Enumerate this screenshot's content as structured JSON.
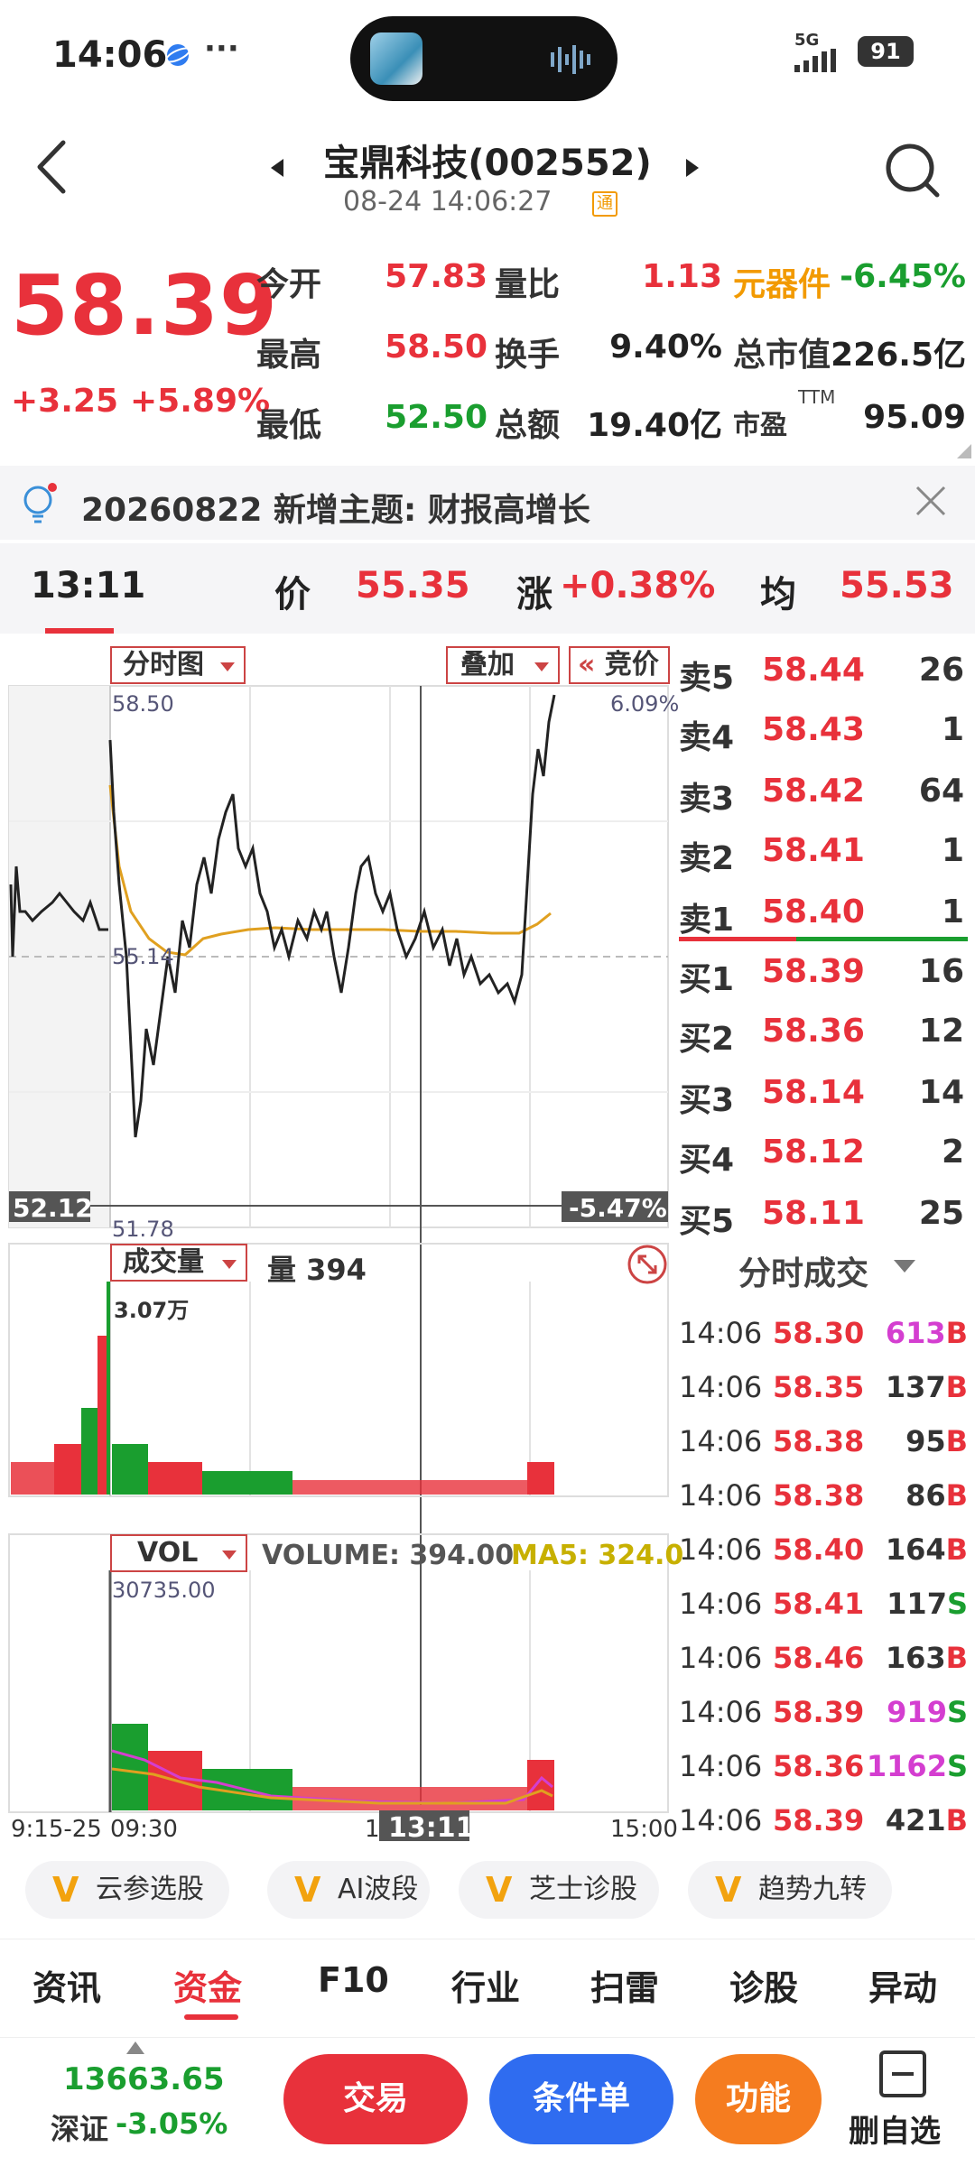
{
  "status_bar": {
    "time": "14:06",
    "extra": "···",
    "network": "5G",
    "battery": "91"
  },
  "header": {
    "stock_name": "宝鼎科技",
    "stock_code": "(002552)",
    "datetime": "08-24 14:06:27",
    "badge": "通"
  },
  "quote": {
    "price": "58.39",
    "change": "+3.25",
    "change_pct": "+5.89%",
    "open_label": "今开",
    "open": "57.83",
    "high_label": "最高",
    "high": "58.50",
    "low_label": "最低",
    "low": "52.50",
    "vol_ratio_label": "量比",
    "vol_ratio": "1.13",
    "turnover_label": "换手",
    "turnover": "9.40%",
    "amount_label": "总额",
    "amount": "19.40亿",
    "sector": "元器件",
    "sector_chg": "-6.45%",
    "mktcap_label": "总市值",
    "mktcap": "226.5亿",
    "pe_label": "市盈",
    "pe_sup": "TTM",
    "pe": "95.09"
  },
  "notification": {
    "text": "20260822 新增主题: 财报高增长"
  },
  "cursor_info": {
    "time": "13:11",
    "price_label": "价",
    "price": "55.35",
    "chg_label": "涨",
    "chg": "+0.38%",
    "avg_label": "均",
    "avg": "55.53"
  },
  "chart": {
    "tab_fenshi": "分时图",
    "tab_overlay": "叠加",
    "tab_auction": "竞价",
    "price_high": "58.50",
    "pct_high": "6.09%",
    "price_mid": "55.14",
    "price_low": "51.78",
    "pct_low_hidden": "6.09%",
    "cursor_price_tag": "52.12",
    "cursor_pct_tag": "-5.47%",
    "vol_tab": "成交量",
    "vol_label": "量 394",
    "vol_max": "3.07万",
    "ind_tab": "VOL",
    "ind_volume": "VOLUME: 394.00",
    "ind_ma5": "MA5: 324.0",
    "ind_max": "30735.00",
    "x_start": "9:15-25",
    "x_open": "09:30",
    "x_cursor": "13:11",
    "x_mark": "1",
    "x_end": "15:00"
  },
  "order_book": [
    {
      "label": "卖5",
      "price": "58.44",
      "vol": "26"
    },
    {
      "label": "卖4",
      "price": "58.43",
      "vol": "1"
    },
    {
      "label": "卖3",
      "price": "58.42",
      "vol": "64"
    },
    {
      "label": "卖2",
      "price": "58.41",
      "vol": "1"
    },
    {
      "label": "卖1",
      "price": "58.40",
      "vol": "1"
    },
    {
      "label": "买1",
      "price": "58.39",
      "vol": "16"
    },
    {
      "label": "买2",
      "price": "58.36",
      "vol": "12"
    },
    {
      "label": "买3",
      "price": "58.14",
      "vol": "14"
    },
    {
      "label": "买4",
      "price": "58.12",
      "vol": "2"
    },
    {
      "label": "买5",
      "price": "58.11",
      "vol": "25"
    }
  ],
  "ticks_title": "分时成交",
  "ticks": [
    {
      "time": "14:06",
      "price": "58.30",
      "vol": "613",
      "side": "B",
      "color": "#d43ed0"
    },
    {
      "time": "14:06",
      "price": "58.35",
      "vol": "137",
      "side": "B",
      "color": "#333333"
    },
    {
      "time": "14:06",
      "price": "58.38",
      "vol": "95",
      "side": "B",
      "color": "#333333"
    },
    {
      "time": "14:06",
      "price": "58.38",
      "vol": "86",
      "side": "B",
      "color": "#333333"
    },
    {
      "time": "14:06",
      "price": "58.40",
      "vol": "164",
      "side": "B",
      "color": "#333333"
    },
    {
      "time": "14:06",
      "price": "58.41",
      "vol": "117",
      "side": "S",
      "color": "#333333"
    },
    {
      "time": "14:06",
      "price": "58.46",
      "vol": "163",
      "side": "B",
      "color": "#333333"
    },
    {
      "time": "14:06",
      "price": "58.39",
      "vol": "919",
      "side": "S",
      "color": "#d43ed0"
    },
    {
      "time": "14:06",
      "price": "58.36",
      "vol": "1162",
      "side": "S",
      "color": "#d43ed0"
    },
    {
      "time": "14:06",
      "price": "58.39",
      "vol": "421",
      "side": "B",
      "color": "#333333"
    }
  ],
  "chips": [
    "云参选股",
    "AI波段",
    "芝士诊股",
    "趋势九转"
  ],
  "tabs": [
    "资讯",
    "资金",
    "F10",
    "行业",
    "扫雷",
    "诊股",
    "异动"
  ],
  "bottom": {
    "index_value": "13663.65",
    "index_name": "深证",
    "index_pct": "-3.05%",
    "trade_btn": "交易",
    "cond_btn": "条件单",
    "func_btn": "功能",
    "del_label": "删自选"
  },
  "colors": {
    "red": "#e8313b",
    "green": "#1a9e2f",
    "orange": "#f29a00",
    "blue": "#2f6cf0",
    "trade": "#e8313b",
    "cond": "#2f6cf0",
    "func": "#f57c1f"
  }
}
